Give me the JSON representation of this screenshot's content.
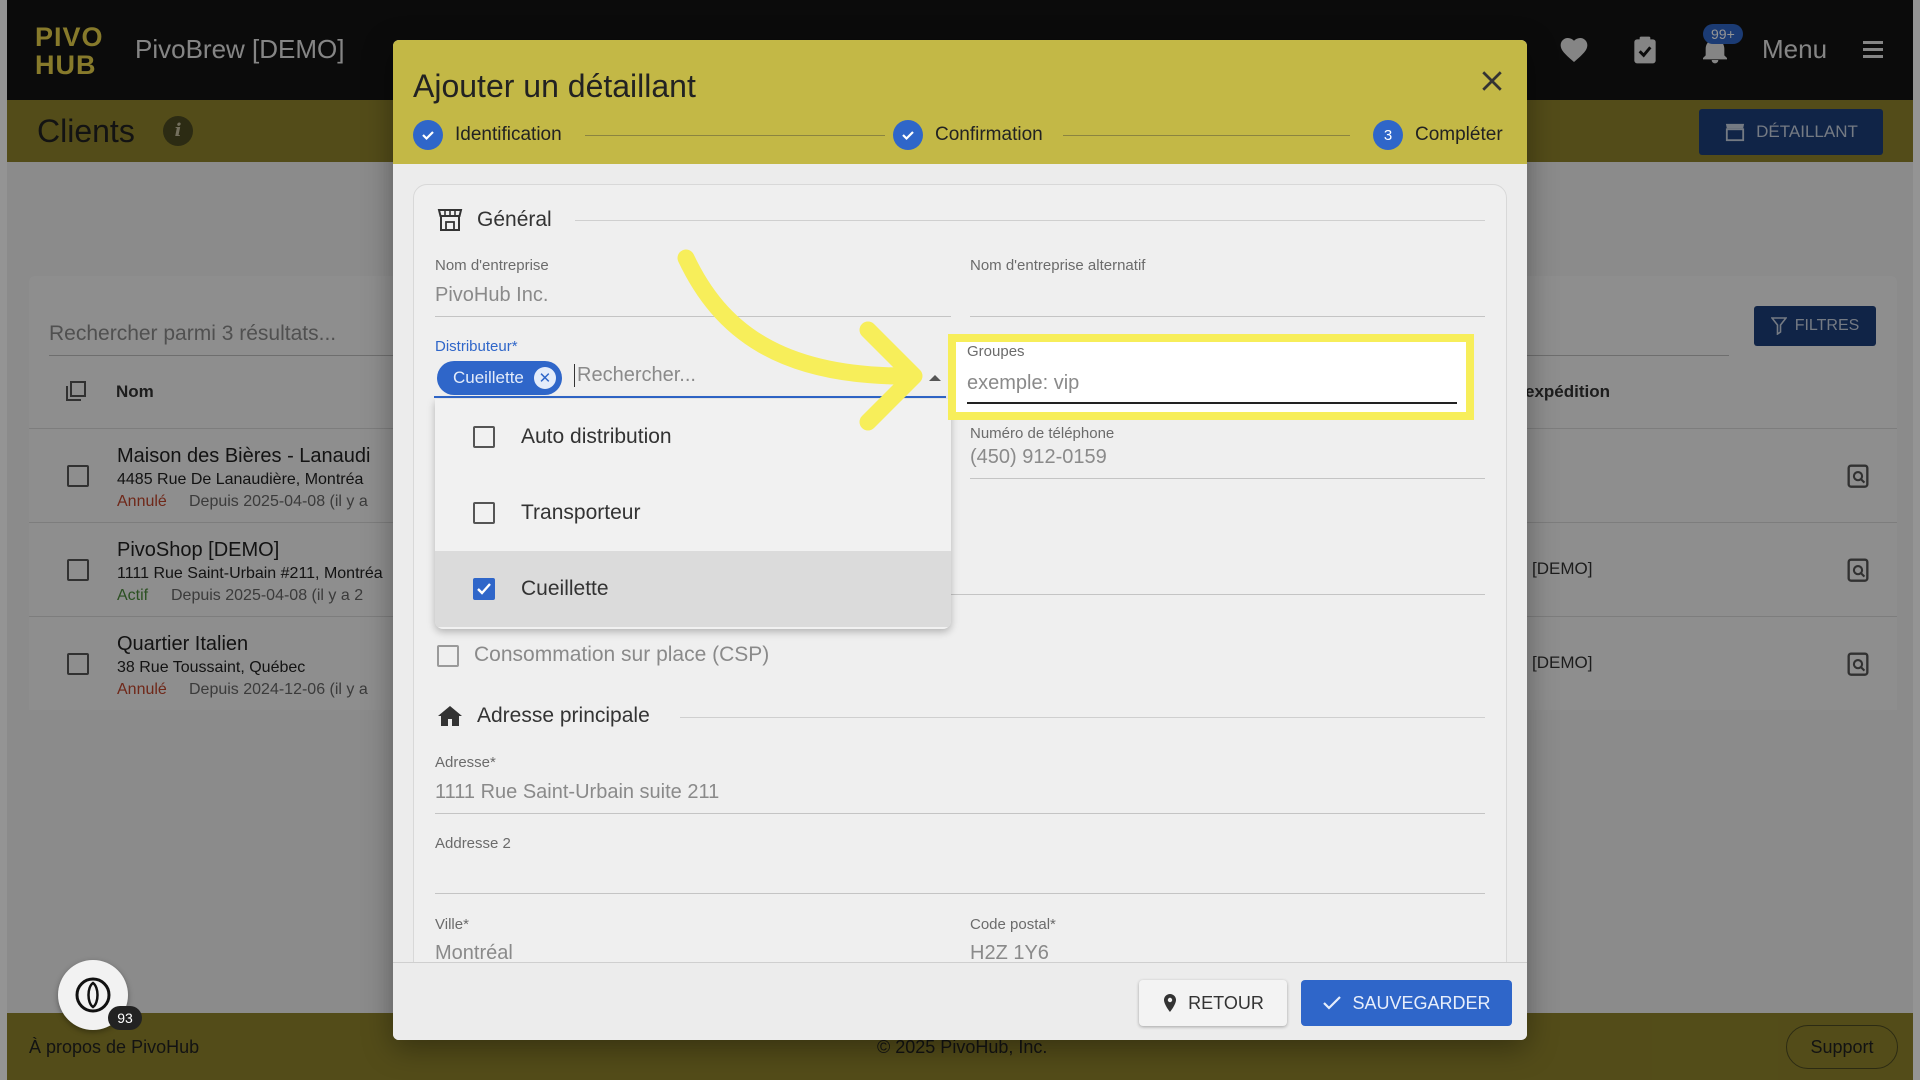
{
  "app": {
    "logo": "PIVO HUB",
    "title": "PivoBrew [DEMO]",
    "notifications_badge": "99+",
    "menu_label": "Menu"
  },
  "page": {
    "title": "Clients",
    "add_button": "DÉTAILLANT",
    "search_placeholder": "Rechercher parmi 3 résultats...",
    "filters_button": "FILTRES",
    "columns": {
      "name": "Nom",
      "shipping": "expédition"
    },
    "rows": [
      {
        "name": "Maison des Bières - Lanaudi",
        "address": "4485 Rue De Lanaudière, Montréa",
        "status": "Annulé",
        "status_color": "#c0452c",
        "since": "Depuis 2025-04-08 (il y a",
        "distributor": ""
      },
      {
        "name": "PivoShop [DEMO]",
        "address": "1111 Rue Saint-Urbain #211, Montréa",
        "status": "Actif",
        "status_color": "#4a8a3a",
        "since": "Depuis 2025-04-08 (il y a 2",
        "distributor": "[DEMO]"
      },
      {
        "name": "Quartier Italien",
        "address": "38 Rue Toussaint, Québec",
        "status": "Annulé",
        "status_color": "#c0452c",
        "since": "Depuis 2024-12-06 (il y a",
        "distributor": "[DEMO]"
      }
    ]
  },
  "footer": {
    "about": "À propos de PivoHub",
    "copyright": "© 2025 PivoHub, Inc.",
    "support": "Support",
    "fab_badge": "93"
  },
  "modal": {
    "title": "Ajouter un détaillant",
    "steps": [
      {
        "label": "Identification",
        "state": "done"
      },
      {
        "label": "Confirmation",
        "state": "done"
      },
      {
        "label": "Compléter",
        "state": "current",
        "number": "3"
      }
    ],
    "general_section": "Général",
    "fields": {
      "company_name_label": "Nom d'entreprise",
      "company_name_value": "PivoHub Inc.",
      "alt_name_label": "Nom d'entreprise alternatif",
      "alt_name_value": "",
      "distributor_label": "Distributeur*",
      "distributor_chip": "Cueillette",
      "distributor_search_placeholder": "Rechercher...",
      "groups_label": "Groupes",
      "groups_placeholder": "exemple: vip",
      "phone_label": "Numéro de téléphone",
      "phone_value": "(450) 912-0159"
    },
    "distributor_options": [
      {
        "label": "Auto distribution",
        "checked": false
      },
      {
        "label": "Transporteur",
        "checked": false
      },
      {
        "label": "Cueillette",
        "checked": true
      }
    ],
    "csp_label": "Consommation sur place (CSP)",
    "address_section": "Adresse principale",
    "address": {
      "address_label": "Adresse*",
      "address_value": "1111 Rue Saint-Urbain suite 211",
      "address2_label": "Addresse 2",
      "address2_value": "",
      "city_label": "Ville*",
      "city_value": "Montréal",
      "postal_label": "Code postal*",
      "postal_value": "H2Z 1Y6"
    },
    "back_button": "RETOUR",
    "save_button": "SAUVEGARDER"
  },
  "colors": {
    "accent_blue": "#2f66c9",
    "header_yellow": "#c3b846",
    "highlight_yellow": "#f7ee5a"
  }
}
